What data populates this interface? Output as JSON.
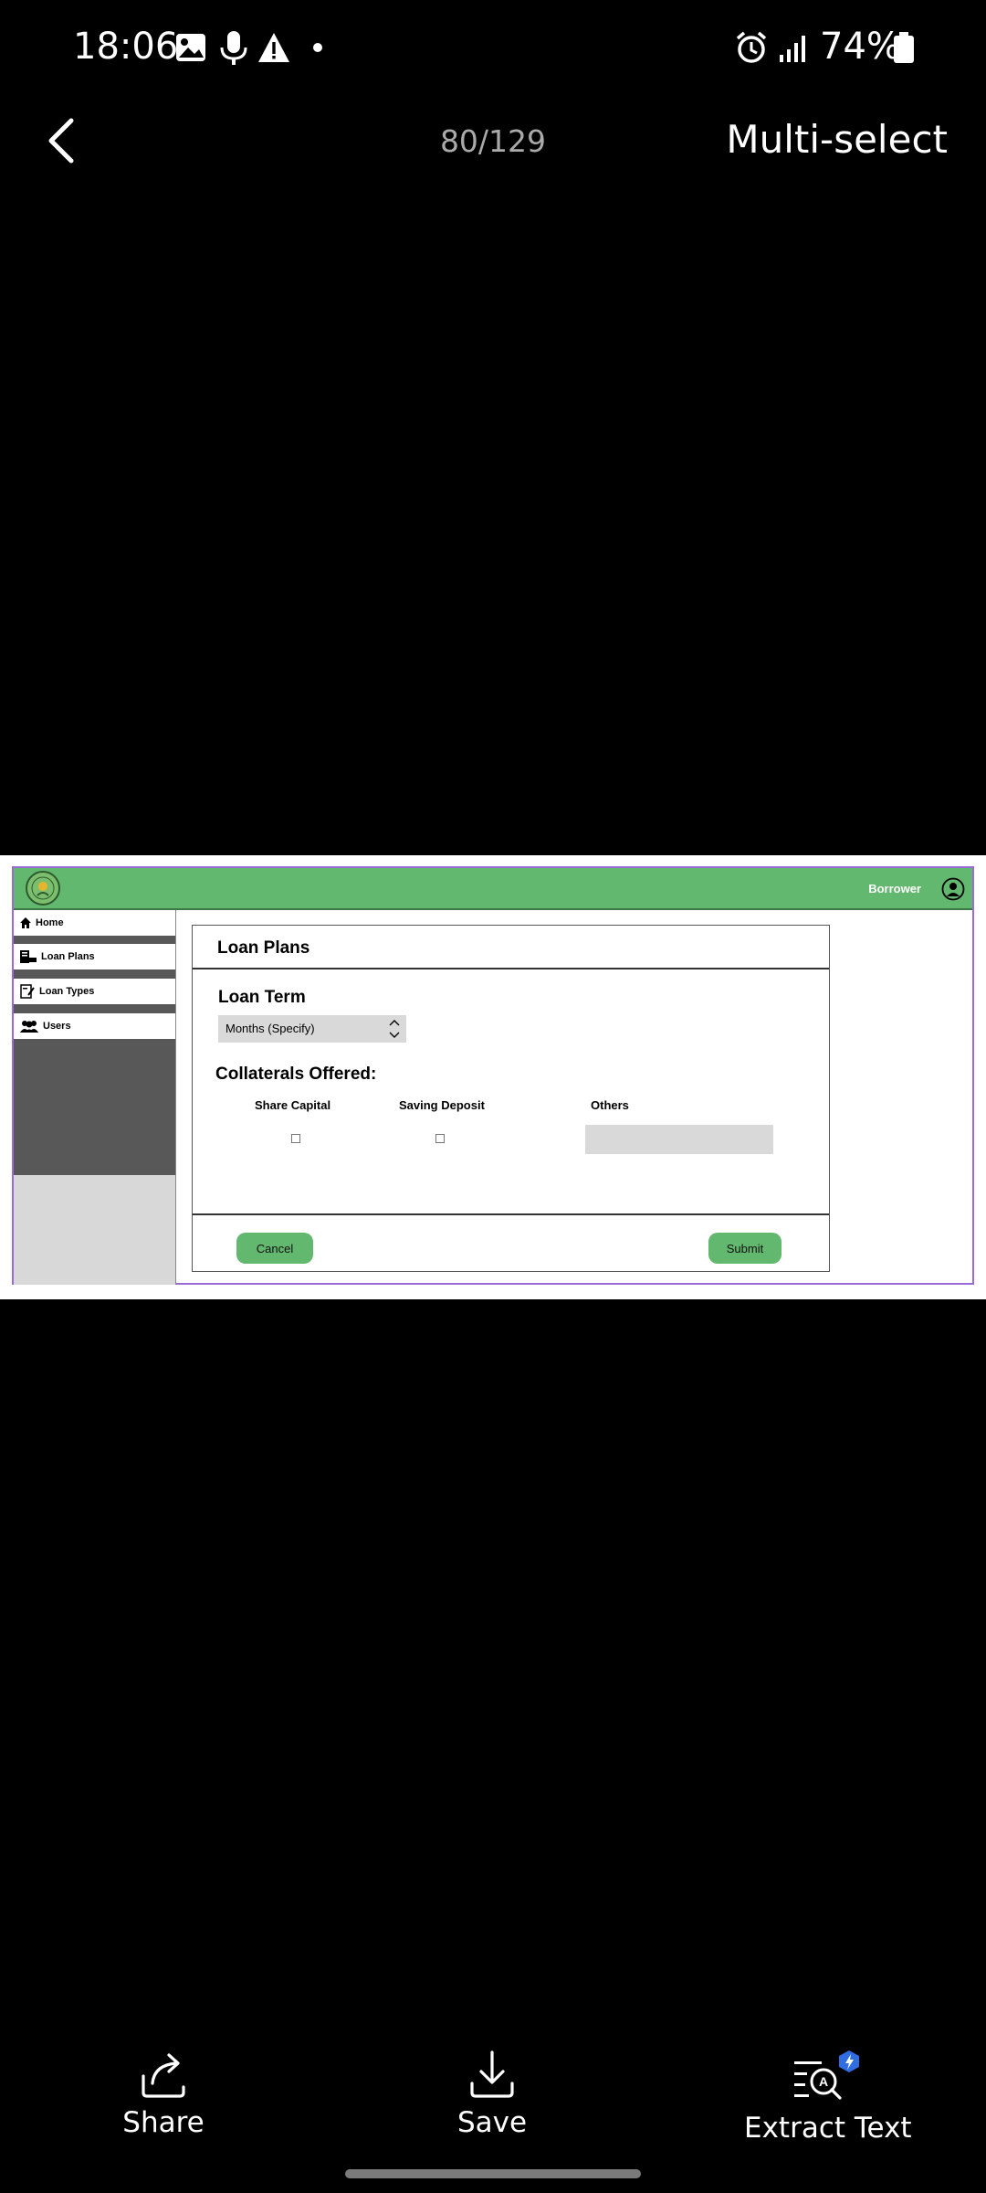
{
  "status_bar": {
    "time": "18:06",
    "battery": "74%",
    "left_icons": [
      "gallery-icon",
      "mic-icon",
      "warning-icon",
      "dot-icon"
    ],
    "right_icons": [
      "alarm-icon",
      "signal-icon",
      "battery-icon"
    ]
  },
  "top_bar": {
    "counter": "80/129",
    "multi_select": "Multi-select"
  },
  "mock": {
    "header": {
      "user": "Borrower"
    },
    "sidebar": [
      {
        "label": "Home",
        "icon": "home-icon"
      },
      {
        "label": "Loan Plans",
        "icon": "loan-plans-icon"
      },
      {
        "label": "Loan Types",
        "icon": "loan-types-icon"
      },
      {
        "label": "Users",
        "icon": "users-icon"
      }
    ],
    "panel": {
      "title": "Loan Plans",
      "loan_term_label": "Loan Term",
      "loan_term_value": "Months (Specify)",
      "collaterals_label": "Collaterals Offered:",
      "columns": [
        "Share Capital",
        "Saving Deposit",
        "Others"
      ],
      "cancel": "Cancel",
      "submit": "Submit"
    },
    "colors": {
      "header": "#62b86e",
      "button": "#62b86e",
      "border": "#9a6ad6"
    }
  },
  "bottom_actions": [
    {
      "label": "Share",
      "icon": "share-icon"
    },
    {
      "label": "Save",
      "icon": "download-icon"
    },
    {
      "label": "Extract Text",
      "icon": "extract-text-icon"
    }
  ]
}
